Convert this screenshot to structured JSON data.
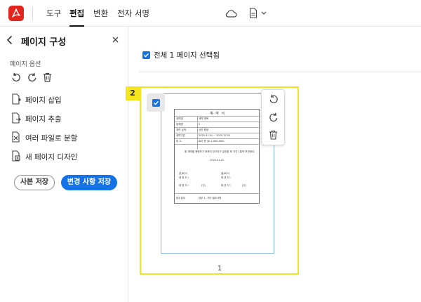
{
  "header": {
    "menus": [
      "도구",
      "편집",
      "변환",
      "전자 서명"
    ],
    "active_menu": "편집"
  },
  "sidebar": {
    "title": "페이지 구성",
    "options_label": "페이지 옵션",
    "items": [
      {
        "label": "페이지 삽입",
        "icon": "insert-page-icon"
      },
      {
        "label": "페이지 추출",
        "icon": "extract-page-icon"
      },
      {
        "label": "여러 파일로 분할",
        "icon": "split-file-icon"
      },
      {
        "label": "새 페이지 디자인",
        "icon": "new-page-design-icon"
      }
    ],
    "save_copy_label": "사본 저장",
    "save_changes_label": "변경 사항 저장"
  },
  "main": {
    "select_all_label": "전체 1 페이지 선택됨",
    "select_all_checked": true,
    "page_badge": "2",
    "page_number": "1",
    "page_checked": true
  },
  "document": {
    "title": "계 약 서",
    "rows": [
      {
        "label": "계약명",
        "value": "계약 제목"
      },
      {
        "label": "업체명",
        "value": "0"
      },
      {
        "label": "계약 금액",
        "value": "금인 원정"
      },
      {
        "label": "계약기간",
        "value": "2025.01.01 ~ 2025.12.31"
      },
      {
        "label": "비 고",
        "value": "특이 문 (#-1,000,000)"
      }
    ],
    "body_text": "위 계약을 증명하기 위하여 당사자가 날인한 후 각각 1통씩 보관한다.",
    "date_text": "2025.01.01",
    "party_a_label": "갑)회 사",
    "party_a_rep": "대 표 자 :",
    "party_b_label": "을)회 사",
    "party_b_rep": "대 표 자 :",
    "seal_a": "(인)",
    "seal_b": "(인)",
    "footer_label": "업무분야",
    "footer_value": "업무 1, 기타 필요사항"
  },
  "colors": {
    "accent": "#1473e6",
    "highlight": "#f5e51f",
    "logo": "#e3261d"
  }
}
